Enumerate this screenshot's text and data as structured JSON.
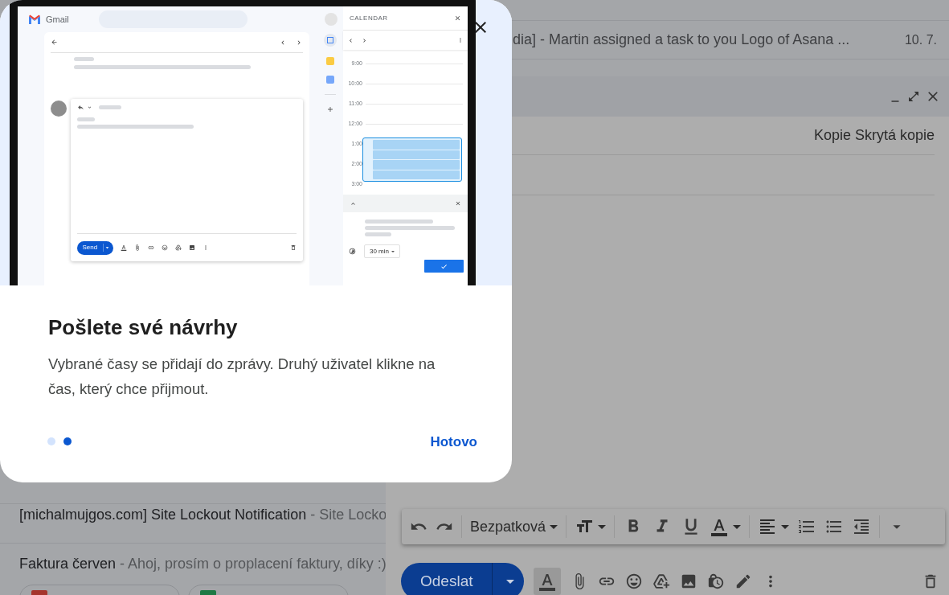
{
  "inbox_rows_top": [
    {
      "text": "dia] - Martin assigned a task to you Logo of Asana ...",
      "date": "10. 7."
    }
  ],
  "inbox_rows_bottom": [
    {
      "subject": "[michalmujgos.com] Site Lockout Notification",
      "snippet": "- Site Locko"
    },
    {
      "subject": "Faktura červen",
      "snippet": "- Ahoj, prosím o proplacení faktury, díky :)",
      "attachments": [
        {
          "kind": "pdf"
        },
        {
          "kind": "sheet"
        }
      ]
    }
  ],
  "compose": {
    "recipient_links": [
      "Kopie",
      "Skrytá kopie"
    ],
    "font": "Bezpatková",
    "send_label": "Odeslat",
    "formatting_toggle": {
      "selected": true
    }
  },
  "dialog": {
    "illustration": {
      "app_name": "Gmail",
      "send_label": "Send",
      "calendar_title": "CALENDAR",
      "times": [
        "9:00",
        "10:00",
        "11:00",
        "12:00",
        "1:00",
        "2:00",
        "3:00"
      ],
      "duration": "30 min"
    },
    "title": "Pošlete své návrhy",
    "body": "Vybrané časy se přidají do zprávy. Druhý uživatel klikne na čas, který chce přijmout.",
    "pages": [
      {
        "selected": false
      },
      {
        "selected": true
      }
    ],
    "done_label": "Hotovo"
  }
}
